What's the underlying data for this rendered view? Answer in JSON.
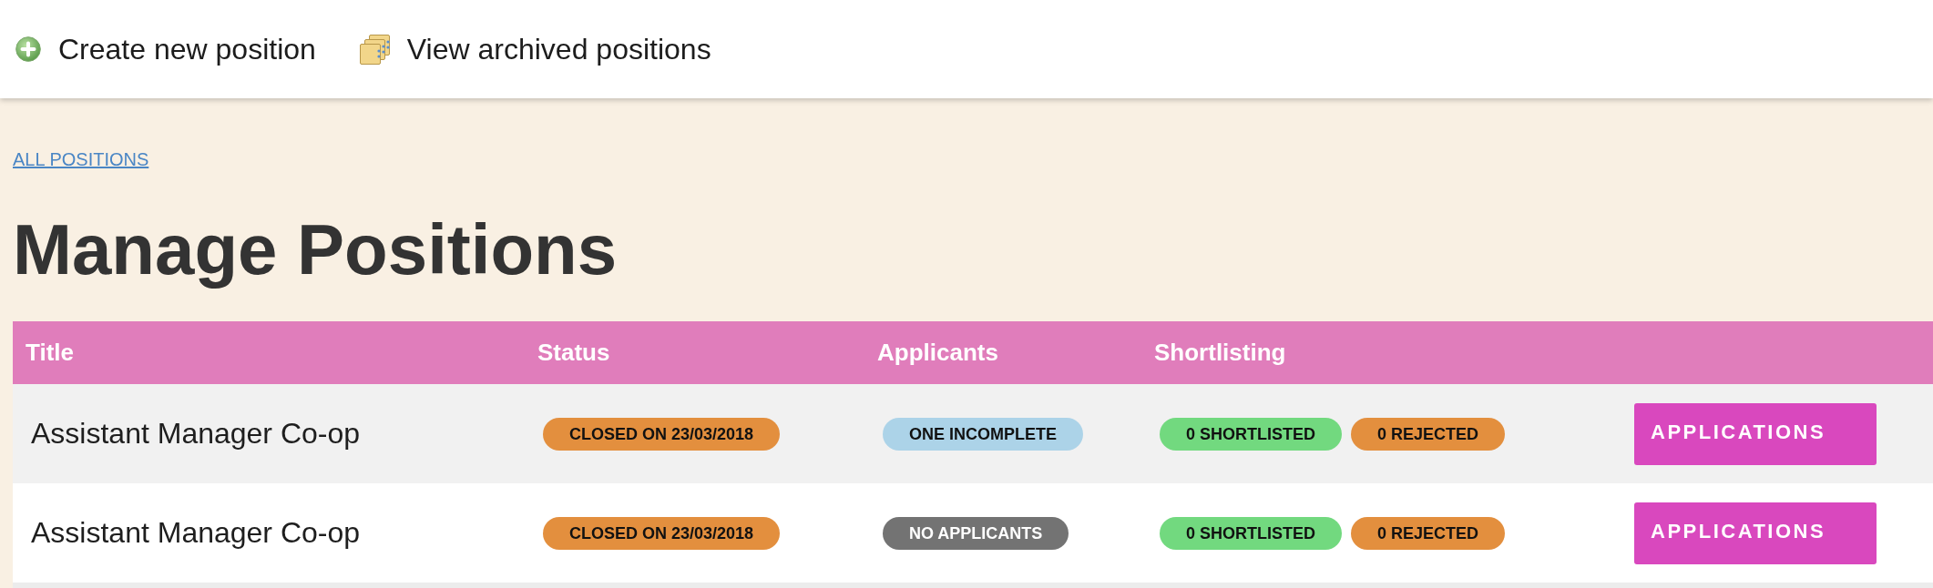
{
  "toolbar": {
    "links": [
      {
        "kind": "create",
        "label": "Create new position"
      },
      {
        "kind": "archive",
        "label": "View archived positions"
      }
    ]
  },
  "breadcrumb": {
    "label": "ALL POSITIONS"
  },
  "page_title": "Manage Positions",
  "table": {
    "columns": [
      "Title",
      "Status",
      "Applicants",
      "Shortlisting"
    ],
    "rows": [
      {
        "title": "Assistant Manager Co-op",
        "status": {
          "label": "CLOSED ON 23/03/2018",
          "color": "#e38f3e"
        },
        "applicants": {
          "label": "ONE INCOMPLETE",
          "color": "#acd3e8"
        },
        "shortlisting": [
          {
            "label": "0 SHORTLISTED",
            "color": "#72d97f"
          },
          {
            "label": "0 REJECTED",
            "color": "#e38f3e"
          }
        ],
        "action": {
          "label": "APPLICATIONS"
        }
      },
      {
        "title": "Assistant Manager Co-op",
        "status": {
          "label": "CLOSED ON 23/03/2018",
          "color": "#e38f3e"
        },
        "applicants": {
          "label": "NO APPLICANTS",
          "color": "#737373"
        },
        "shortlisting": [
          {
            "label": "0 SHORTLISTED",
            "color": "#72d97f"
          },
          {
            "label": "0 REJECTED",
            "color": "#e38f3e"
          }
        ],
        "action": {
          "label": "APPLICATIONS"
        }
      }
    ]
  }
}
